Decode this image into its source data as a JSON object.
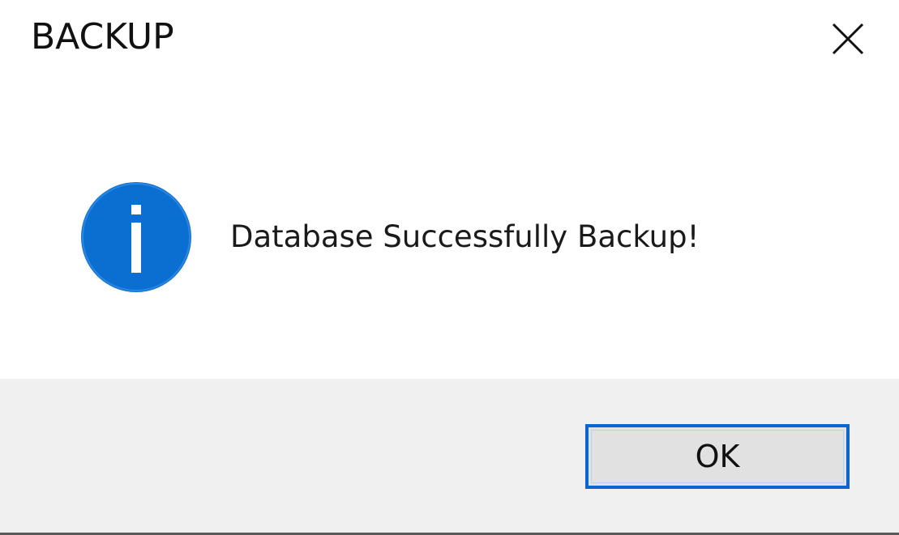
{
  "window": {
    "title": "BACKUP",
    "close_icon": "close-icon"
  },
  "message": {
    "icon": "info-icon",
    "text": "Database Successfully Backup!"
  },
  "buttons": {
    "ok_label": "OK"
  },
  "colors": {
    "info_blue": "#0a6fd0",
    "focus_border": "#0a64d2",
    "footer_bg": "#f0f0f0",
    "button_bg": "#e1e1e1"
  }
}
